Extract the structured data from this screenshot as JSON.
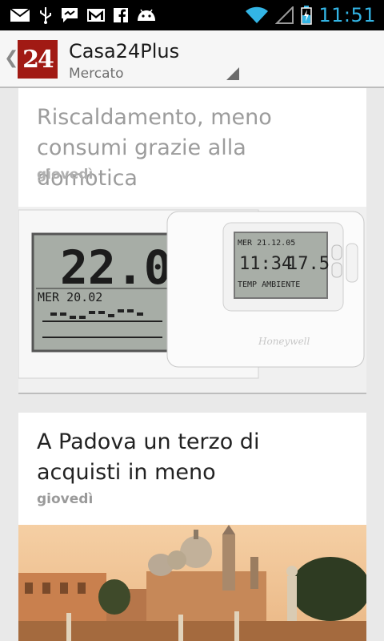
{
  "status_bar": {
    "time": "11:51",
    "left_icons": [
      "mail-icon",
      "usb-icon",
      "chat-icon",
      "gmail-icon",
      "facebook-icon",
      "android-icon"
    ],
    "right_icons": [
      "wifi-icon",
      "signal-icon",
      "battery-charging-icon"
    ],
    "accent_color": "#33b5e5"
  },
  "action_bar": {
    "logo_text": "24",
    "title": "Casa24Plus",
    "subtitle": "Mercato"
  },
  "articles": [
    {
      "title": "Riscaldamento, meno consumi grazie alla domotica",
      "date": "giovedì",
      "image": "thermostat-photo"
    },
    {
      "title": "A Padova un terzo di acquisti in meno",
      "date": "giovedì",
      "image": "padova-city-photo"
    }
  ],
  "thermostat": {
    "temp": "22.0",
    "date_line": "MER 20.02",
    "small_date": "MER 21.12.05",
    "small_time": "11:34",
    "small_temp": "17.5",
    "small_label": "TEMP AMBIENTE",
    "brand": "Honeywell"
  }
}
